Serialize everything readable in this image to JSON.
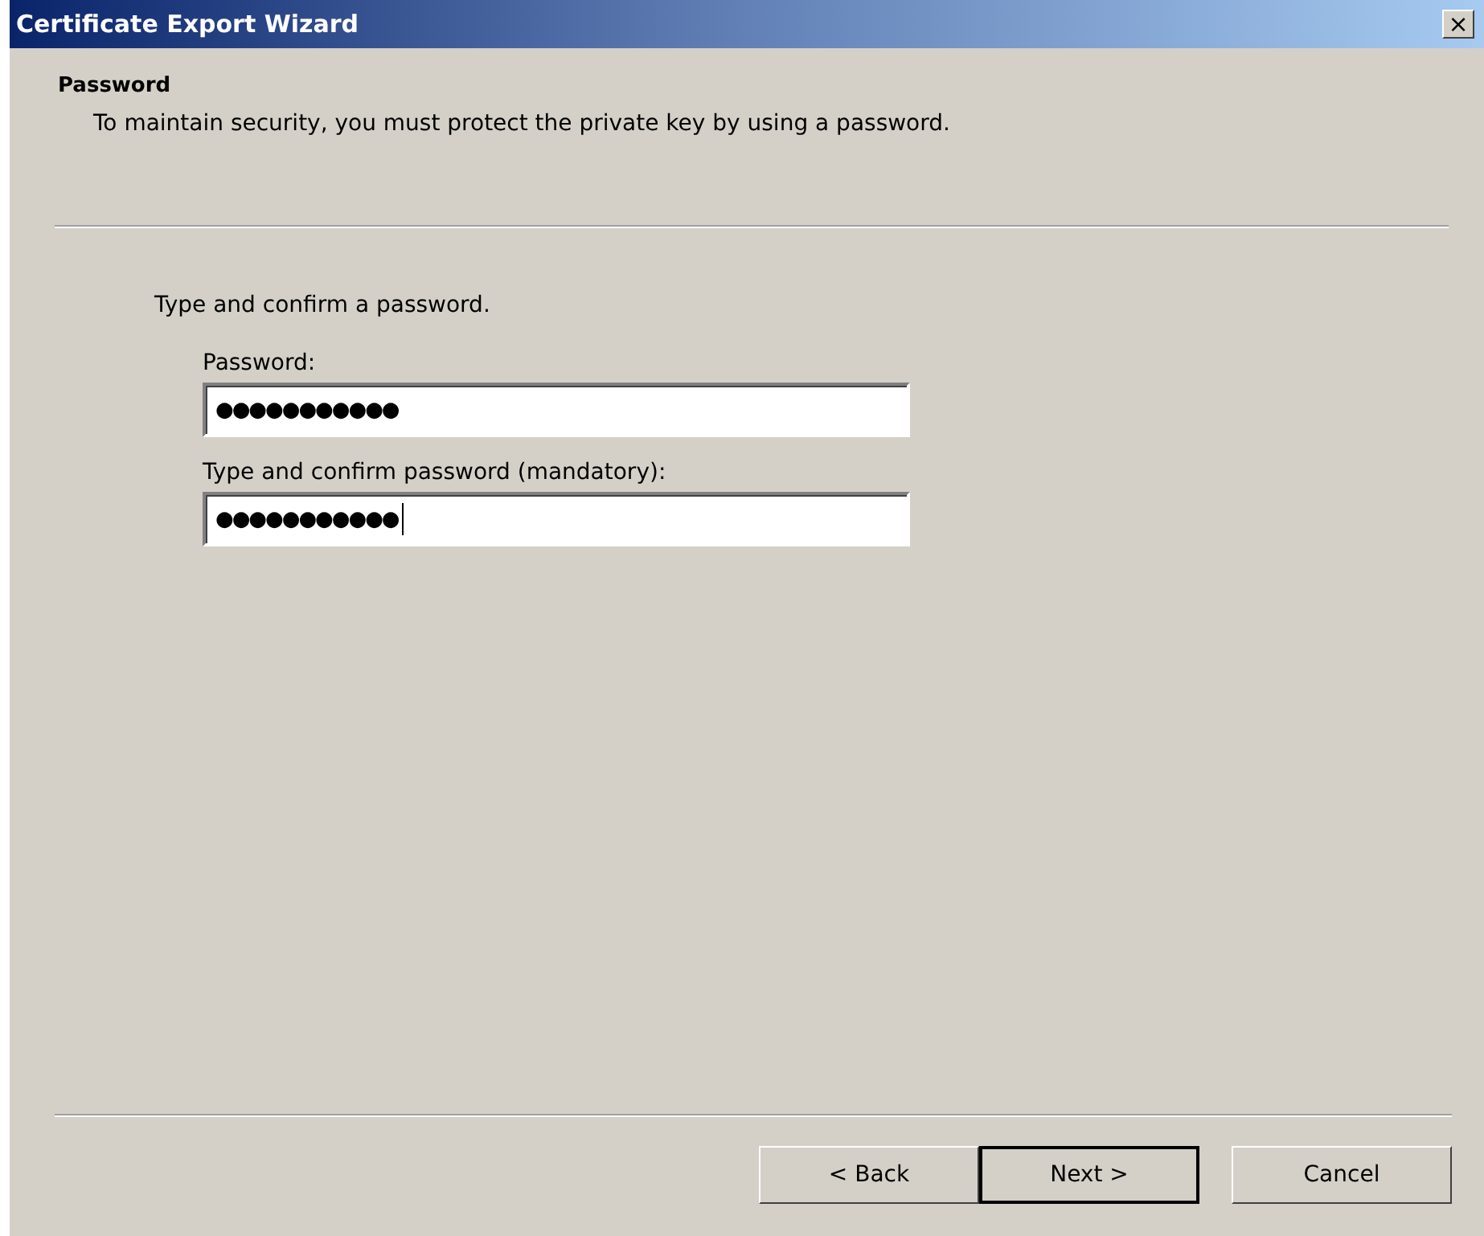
{
  "window": {
    "title": "Certificate Export Wizard",
    "close_label": "×"
  },
  "header": {
    "title": "Password",
    "subtitle": "To maintain security, you must protect the private key by using a password."
  },
  "instruction": "Type and confirm a password.",
  "fields": [
    {
      "label": "Password:",
      "value": "●●●●●●●●●●●",
      "focused": false
    },
    {
      "label": "Type and confirm password (mandatory):",
      "value": "●●●●●●●●●●●",
      "focused": true
    }
  ],
  "buttons": [
    {
      "label": "< Back",
      "default": false
    },
    {
      "label": "Next >",
      "default": true
    },
    {
      "label": "Cancel",
      "default": false
    }
  ]
}
